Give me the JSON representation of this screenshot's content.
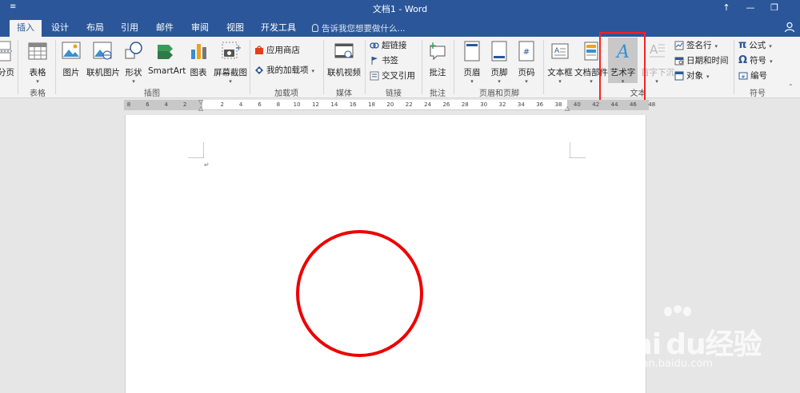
{
  "titlebar": {
    "quick_access": "≡",
    "title": "文档1 - Word",
    "ribbon_display": "↑",
    "minimize": "—",
    "restore": "❐"
  },
  "tabs": {
    "insert": "插入",
    "design": "设计",
    "layout": "布局",
    "references": "引用",
    "mailings": "邮件",
    "review": "审阅",
    "view": "视图",
    "developer": "开发工具",
    "tell_me": "告诉我您想要做什么..."
  },
  "ribbon": {
    "page_break": "分页",
    "table": "表格",
    "table_group": "表格",
    "pictures": "图片",
    "online_pictures": "联机图片",
    "shapes": "形状",
    "smartart": "SmartArt",
    "chart": "图表",
    "screenshot": "屏幕截图",
    "illustrations_group": "插图",
    "store": "应用商店",
    "my_addins": "我的加载项",
    "addins_group": "加载项",
    "online_video": "联机视频",
    "media_group": "媒体",
    "hyperlink": "超链接",
    "bookmark": "书签",
    "cross_reference": "交叉引用",
    "links_group": "链接",
    "comment": "批注",
    "comments_group": "批注",
    "header": "页眉",
    "footer": "页脚",
    "page_number": "页码",
    "header_footer_group": "页眉和页脚",
    "text_box": "文本框",
    "quick_parts": "文档部件",
    "wordart": "艺术字",
    "drop_cap": "首字下沉",
    "signature_line": "签名行",
    "date_time": "日期和时间",
    "object": "对象",
    "text_group": "文本",
    "equation": "公式",
    "symbol": "符号",
    "numbering": "编号",
    "symbols_group": "符号",
    "pi_glyph": "π",
    "omega_glyph": "Ω",
    "wordart_glyph": "A",
    "dropcap_glyph": "A",
    "page_number_glyph": "#"
  },
  "ruler_ticks": [
    "8",
    "6",
    "4",
    "2",
    "",
    "2",
    "4",
    "6",
    "8",
    "10",
    "12",
    "14",
    "16",
    "18",
    "20",
    "22",
    "24",
    "26",
    "28",
    "30",
    "32",
    "34",
    "36",
    "38",
    "40",
    "42",
    "44",
    "46",
    "48"
  ],
  "document": {
    "paragraph_mark": "↵"
  },
  "watermark": {
    "brand": "Bai du经验",
    "url": "jingyan.baidu.com"
  },
  "colors": {
    "word_blue": "#2b579a",
    "highlight_red": "#ff2020",
    "circle_red": "#ee0000"
  }
}
